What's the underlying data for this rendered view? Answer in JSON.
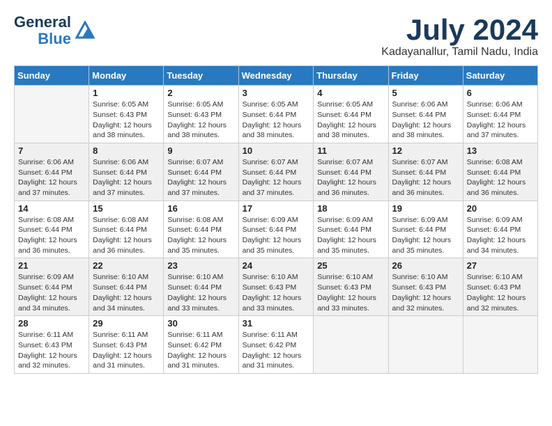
{
  "logo": {
    "line1": "General",
    "line2": "Blue"
  },
  "title": "July 2024",
  "subtitle": "Kadayanallur, Tamil Nadu, India",
  "days_header": [
    "Sunday",
    "Monday",
    "Tuesday",
    "Wednesday",
    "Thursday",
    "Friday",
    "Saturday"
  ],
  "weeks": [
    [
      {
        "day": "",
        "empty": true
      },
      {
        "day": "1",
        "sunrise": "Sunrise: 6:05 AM",
        "sunset": "Sunset: 6:43 PM",
        "daylight": "Daylight: 12 hours and 38 minutes."
      },
      {
        "day": "2",
        "sunrise": "Sunrise: 6:05 AM",
        "sunset": "Sunset: 6:43 PM",
        "daylight": "Daylight: 12 hours and 38 minutes."
      },
      {
        "day": "3",
        "sunrise": "Sunrise: 6:05 AM",
        "sunset": "Sunset: 6:44 PM",
        "daylight": "Daylight: 12 hours and 38 minutes."
      },
      {
        "day": "4",
        "sunrise": "Sunrise: 6:05 AM",
        "sunset": "Sunset: 6:44 PM",
        "daylight": "Daylight: 12 hours and 38 minutes."
      },
      {
        "day": "5",
        "sunrise": "Sunrise: 6:06 AM",
        "sunset": "Sunset: 6:44 PM",
        "daylight": "Daylight: 12 hours and 38 minutes."
      },
      {
        "day": "6",
        "sunrise": "Sunrise: 6:06 AM",
        "sunset": "Sunset: 6:44 PM",
        "daylight": "Daylight: 12 hours and 37 minutes."
      }
    ],
    [
      {
        "day": "7",
        "sunrise": "Sunrise: 6:06 AM",
        "sunset": "Sunset: 6:44 PM",
        "daylight": "Daylight: 12 hours and 37 minutes."
      },
      {
        "day": "8",
        "sunrise": "Sunrise: 6:06 AM",
        "sunset": "Sunset: 6:44 PM",
        "daylight": "Daylight: 12 hours and 37 minutes."
      },
      {
        "day": "9",
        "sunrise": "Sunrise: 6:07 AM",
        "sunset": "Sunset: 6:44 PM",
        "daylight": "Daylight: 12 hours and 37 minutes."
      },
      {
        "day": "10",
        "sunrise": "Sunrise: 6:07 AM",
        "sunset": "Sunset: 6:44 PM",
        "daylight": "Daylight: 12 hours and 37 minutes."
      },
      {
        "day": "11",
        "sunrise": "Sunrise: 6:07 AM",
        "sunset": "Sunset: 6:44 PM",
        "daylight": "Daylight: 12 hours and 36 minutes."
      },
      {
        "day": "12",
        "sunrise": "Sunrise: 6:07 AM",
        "sunset": "Sunset: 6:44 PM",
        "daylight": "Daylight: 12 hours and 36 minutes."
      },
      {
        "day": "13",
        "sunrise": "Sunrise: 6:08 AM",
        "sunset": "Sunset: 6:44 PM",
        "daylight": "Daylight: 12 hours and 36 minutes."
      }
    ],
    [
      {
        "day": "14",
        "sunrise": "Sunrise: 6:08 AM",
        "sunset": "Sunset: 6:44 PM",
        "daylight": "Daylight: 12 hours and 36 minutes."
      },
      {
        "day": "15",
        "sunrise": "Sunrise: 6:08 AM",
        "sunset": "Sunset: 6:44 PM",
        "daylight": "Daylight: 12 hours and 36 minutes."
      },
      {
        "day": "16",
        "sunrise": "Sunrise: 6:08 AM",
        "sunset": "Sunset: 6:44 PM",
        "daylight": "Daylight: 12 hours and 35 minutes."
      },
      {
        "day": "17",
        "sunrise": "Sunrise: 6:09 AM",
        "sunset": "Sunset: 6:44 PM",
        "daylight": "Daylight: 12 hours and 35 minutes."
      },
      {
        "day": "18",
        "sunrise": "Sunrise: 6:09 AM",
        "sunset": "Sunset: 6:44 PM",
        "daylight": "Daylight: 12 hours and 35 minutes."
      },
      {
        "day": "19",
        "sunrise": "Sunrise: 6:09 AM",
        "sunset": "Sunset: 6:44 PM",
        "daylight": "Daylight: 12 hours and 35 minutes."
      },
      {
        "day": "20",
        "sunrise": "Sunrise: 6:09 AM",
        "sunset": "Sunset: 6:44 PM",
        "daylight": "Daylight: 12 hours and 34 minutes."
      }
    ],
    [
      {
        "day": "21",
        "sunrise": "Sunrise: 6:09 AM",
        "sunset": "Sunset: 6:44 PM",
        "daylight": "Daylight: 12 hours and 34 minutes."
      },
      {
        "day": "22",
        "sunrise": "Sunrise: 6:10 AM",
        "sunset": "Sunset: 6:44 PM",
        "daylight": "Daylight: 12 hours and 34 minutes."
      },
      {
        "day": "23",
        "sunrise": "Sunrise: 6:10 AM",
        "sunset": "Sunset: 6:44 PM",
        "daylight": "Daylight: 12 hours and 33 minutes."
      },
      {
        "day": "24",
        "sunrise": "Sunrise: 6:10 AM",
        "sunset": "Sunset: 6:43 PM",
        "daylight": "Daylight: 12 hours and 33 minutes."
      },
      {
        "day": "25",
        "sunrise": "Sunrise: 6:10 AM",
        "sunset": "Sunset: 6:43 PM",
        "daylight": "Daylight: 12 hours and 33 minutes."
      },
      {
        "day": "26",
        "sunrise": "Sunrise: 6:10 AM",
        "sunset": "Sunset: 6:43 PM",
        "daylight": "Daylight: 12 hours and 32 minutes."
      },
      {
        "day": "27",
        "sunrise": "Sunrise: 6:10 AM",
        "sunset": "Sunset: 6:43 PM",
        "daylight": "Daylight: 12 hours and 32 minutes."
      }
    ],
    [
      {
        "day": "28",
        "sunrise": "Sunrise: 6:11 AM",
        "sunset": "Sunset: 6:43 PM",
        "daylight": "Daylight: 12 hours and 32 minutes."
      },
      {
        "day": "29",
        "sunrise": "Sunrise: 6:11 AM",
        "sunset": "Sunset: 6:43 PM",
        "daylight": "Daylight: 12 hours and 31 minutes."
      },
      {
        "day": "30",
        "sunrise": "Sunrise: 6:11 AM",
        "sunset": "Sunset: 6:42 PM",
        "daylight": "Daylight: 12 hours and 31 minutes."
      },
      {
        "day": "31",
        "sunrise": "Sunrise: 6:11 AM",
        "sunset": "Sunset: 6:42 PM",
        "daylight": "Daylight: 12 hours and 31 minutes."
      },
      {
        "day": "",
        "empty": true
      },
      {
        "day": "",
        "empty": true
      },
      {
        "day": "",
        "empty": true
      }
    ]
  ]
}
